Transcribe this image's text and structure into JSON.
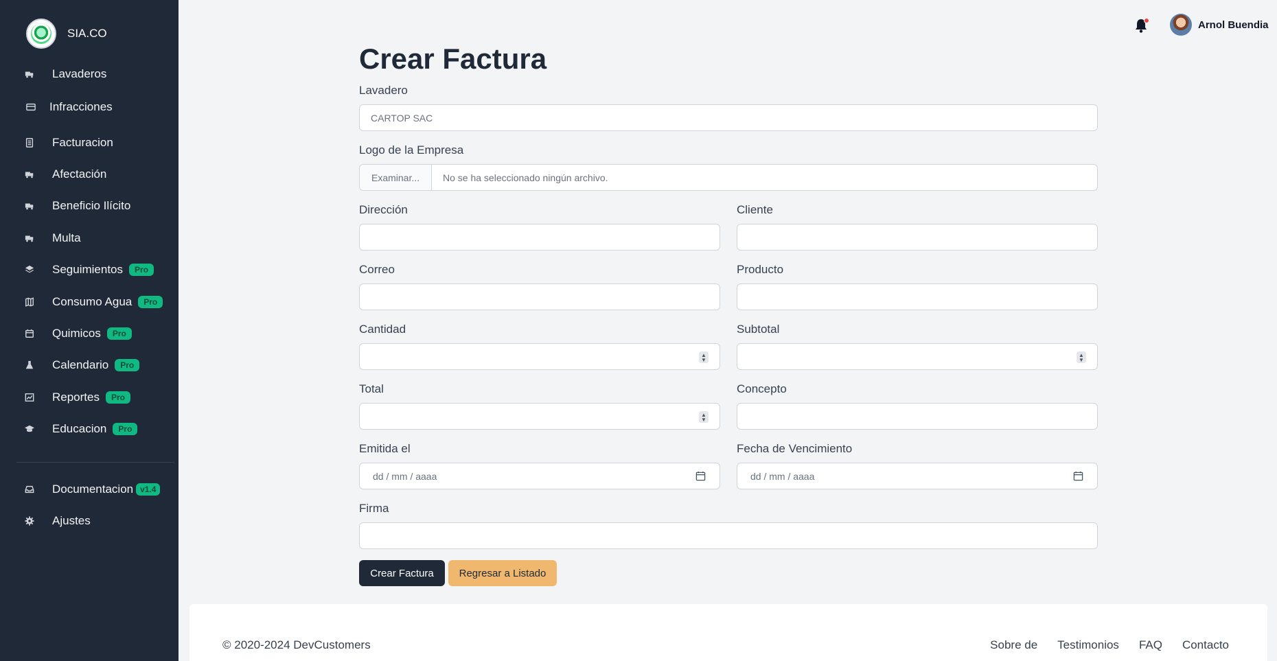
{
  "app": {
    "brand_name": "SIA.CO"
  },
  "sidebar": {
    "items": [
      {
        "label": "Lavaderos",
        "icon": "truck-icon"
      },
      {
        "label": "Infracciones",
        "icon": "credit-card-icon"
      },
      {
        "label": "Facturacion",
        "icon": "receipt-icon"
      },
      {
        "label": "Afectación",
        "icon": "truck-icon"
      },
      {
        "label": "Beneficio Ilícito",
        "icon": "truck-icon"
      },
      {
        "label": "Multa",
        "icon": "truck-icon"
      },
      {
        "label": "Seguimientos",
        "icon": "layers-icon",
        "badge": "Pro"
      },
      {
        "label": "Consumo Agua",
        "icon": "map-icon",
        "badge": "Pro"
      },
      {
        "label": "Quimicos",
        "icon": "calendar-icon",
        "badge": "Pro"
      },
      {
        "label": "Calendario",
        "icon": "flask-icon",
        "badge": "Pro"
      },
      {
        "label": "Reportes",
        "icon": "chart-icon",
        "badge": "Pro"
      },
      {
        "label": "Educacion",
        "icon": "graduation-cap-icon",
        "badge": "Pro"
      },
      {
        "label": "Documentacion",
        "icon": "inbox-icon",
        "badge": "v1.4"
      },
      {
        "label": "Ajustes",
        "icon": "gear-icon"
      }
    ]
  },
  "header": {
    "user_name": "Arnol Buendia"
  },
  "form": {
    "title": "Crear Factura",
    "lavadero": {
      "label": "Lavadero",
      "value": "CARTOP SAC"
    },
    "logo": {
      "label": "Logo de la Empresa",
      "button": "Examinar...",
      "status": "No se ha seleccionado ningún archivo."
    },
    "direccion": {
      "label": "Dirección"
    },
    "cliente": {
      "label": "Cliente"
    },
    "correo": {
      "label": "Correo"
    },
    "producto": {
      "label": "Producto"
    },
    "cantidad": {
      "label": "Cantidad"
    },
    "subtotal": {
      "label": "Subtotal"
    },
    "total": {
      "label": "Total"
    },
    "concepto": {
      "label": "Concepto"
    },
    "emitida": {
      "label": "Emitida el",
      "placeholder": "dd / mm / aaaa"
    },
    "vencimiento": {
      "label": "Fecha de Vencimiento",
      "placeholder": "dd / mm / aaaa"
    },
    "firma": {
      "label": "Firma"
    },
    "submit_label": "Crear Factura",
    "back_label": "Regresar a Listado"
  },
  "footer": {
    "copyright": "© 2020-2024 DevCustomers",
    "links": [
      "Sobre de",
      "Testimonios",
      "FAQ",
      "Contacto"
    ]
  },
  "colors": {
    "sidebar_bg": "#1f2937",
    "badge": "#10b981",
    "primary_button": "#1f2937",
    "secondary_button": "#f0b86e",
    "notification_dot": "#ef4444"
  }
}
